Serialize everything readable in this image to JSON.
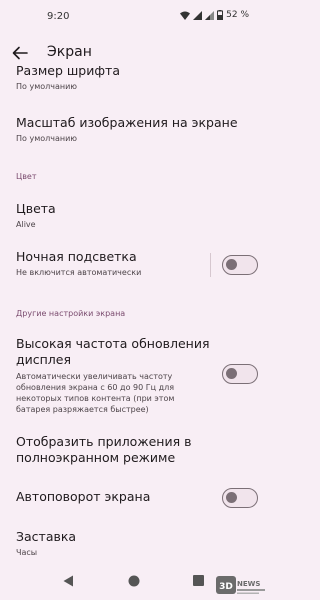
{
  "status_bar": {
    "time": "9:20",
    "battery": "52 %",
    "icons": [
      "wifi-icon",
      "signal-icon",
      "signal-icon",
      "battery-icon"
    ]
  },
  "header": {
    "title": "Экран"
  },
  "settings": {
    "font_size_title": "Размер шрифта",
    "font_size_summary": "По умолчанию",
    "display_scale_title": "Масштаб изображения на экране",
    "display_scale_summary": "По умолчанию",
    "color_section": "Цвет",
    "colors_title": "Цвета",
    "colors_summary": "Alive",
    "night_light_title": "Ночная подсветка",
    "night_light_summary": "Не включится автоматически",
    "other_section": "Другие настройки экрана",
    "refresh_title_line1": "Высокая частота обновления",
    "refresh_title_line2": "дисплея",
    "refresh_summary_line1": "Автоматически увеличивать частоту",
    "refresh_summary_line2": "обновления экрана с 60 до 90 Гц для",
    "refresh_summary_line3": "некоторых типов контента (при этом",
    "refresh_summary_line4": "батарея разряжается быстрее)",
    "fullscreen_apps_line1": "Отобразить приложения в",
    "fullscreen_apps_line2": "полноэкранном режиме",
    "auto_rotate_title": "Автоповорот экрана",
    "screensaver_title": "Заставка",
    "screensaver_summary": "Часы"
  },
  "toggles": {
    "night_light": false,
    "high_refresh_rate": false,
    "auto_rotate": false
  },
  "colors": {
    "background": "#f8eef5",
    "section_header": "#7b4c6f",
    "toggle_outline": "#7b6f76"
  }
}
